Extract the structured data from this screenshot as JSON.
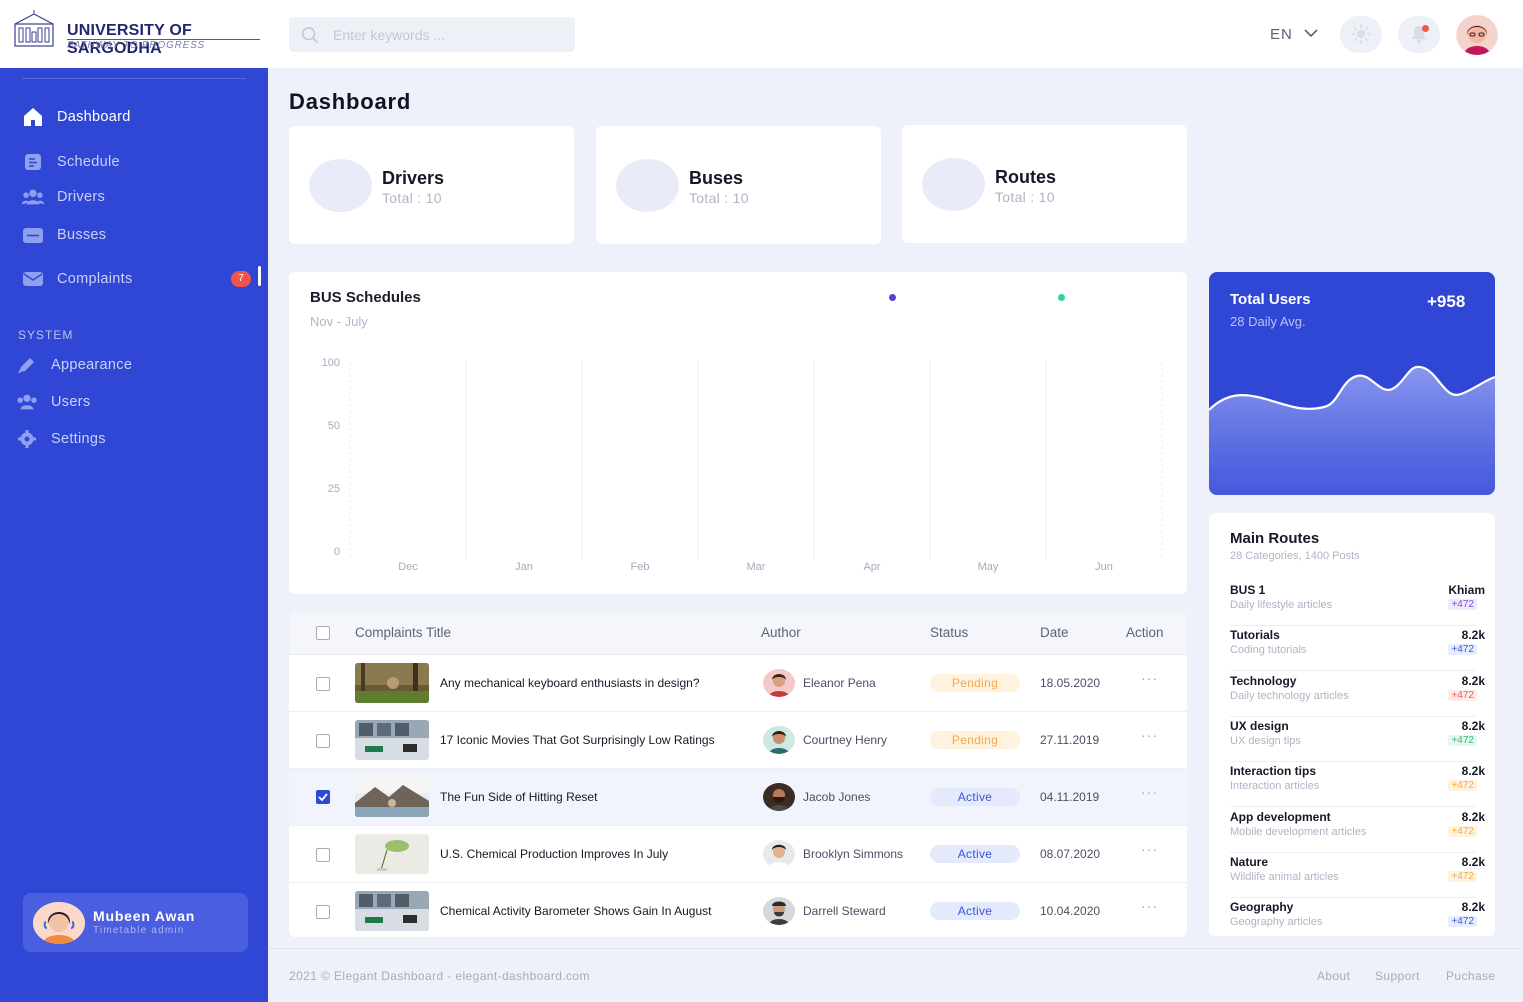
{
  "header": {
    "logo_title": "UNIVERSITY OF SARGODHA",
    "logo_subtitle": "PATHWAY TO PROGRESS",
    "search_placeholder": "Enter keywords ...",
    "language": "EN"
  },
  "sidebar": {
    "items": [
      {
        "label": "Dashboard",
        "icon": "home-icon"
      },
      {
        "label": "Schedule",
        "icon": "document-icon"
      },
      {
        "label": "Drivers",
        "icon": "users-icon"
      },
      {
        "label": "Busses",
        "icon": "folder-icon"
      },
      {
        "label": "Complaints",
        "icon": "mail-icon",
        "badge": "7"
      }
    ],
    "system_title": "SYSTEM",
    "system_items": [
      {
        "label": "Appearance",
        "icon": "pen-icon"
      },
      {
        "label": "Users",
        "icon": "users-icon"
      },
      {
        "label": "Settings",
        "icon": "gear-icon"
      }
    ],
    "user": {
      "name": "Mubeen Awan",
      "role": "Timetable admin"
    }
  },
  "main": {
    "title": "Dashboard",
    "stats": [
      {
        "title": "Drivers",
        "sub": "Total : 10"
      },
      {
        "title": "Buses",
        "sub": "Total : 10"
      },
      {
        "title": "Routes",
        "sub": "Total : 10"
      }
    ]
  },
  "chart_data": {
    "type": "bar",
    "title": "BUS Schedules",
    "subtitle": "Nov - July",
    "categories": [
      "Dec",
      "Jan",
      "Feb",
      "Mar",
      "Apr",
      "May",
      "Jun"
    ],
    "y_ticks": [
      "100",
      "50",
      "25",
      "0"
    ],
    "series": [
      {
        "color": "#5b3fd9",
        "values": [
          0,
          0,
          0,
          0,
          0,
          0,
          0
        ]
      },
      {
        "color": "#2fd39b",
        "values": [
          0,
          0,
          0,
          0,
          0,
          0,
          0
        ]
      }
    ]
  },
  "table": {
    "headers": {
      "title": "Complaints  Title",
      "author": "Author",
      "status": "Status",
      "date": "Date",
      "action": "Action"
    },
    "rows": [
      {
        "title": "Any mechanical keyboard enthusiasts in design?",
        "author": "Eleanor Pena",
        "status": "Pending",
        "date": "18.05.2020",
        "checked": false
      },
      {
        "title": "17 Iconic Movies That Got Surprisingly Low Ratings",
        "author": "Courtney Henry",
        "status": "Pending",
        "date": "27.11.2019",
        "checked": false
      },
      {
        "title": "The Fun Side of Hitting Reset",
        "author": "Jacob Jones",
        "status": "Active",
        "date": "04.11.2019",
        "checked": true
      },
      {
        "title": "U.S. Chemical Production Improves In July",
        "author": "Brooklyn Simmons",
        "status": "Active",
        "date": "08.07.2020",
        "checked": false
      },
      {
        "title": "Chemical Activity Barometer Shows Gain In August",
        "author": "Darrell Steward",
        "status": "Active",
        "date": "10.04.2020",
        "checked": false
      }
    ],
    "action_symbol": "···"
  },
  "users_card": {
    "title": "Total Users",
    "value": "+958",
    "sub": "28 Daily Avg."
  },
  "routes_card": {
    "title": "Main Routes",
    "sub": "28 Categories, 1400 Posts",
    "items": [
      {
        "name": "BUS 1",
        "desc": "Daily lifestyle articles",
        "value": "Khiam",
        "badge": "+472",
        "badge_color": "#7b4fe0",
        "badge_bg": "#efe9fd"
      },
      {
        "name": "Tutorials",
        "desc": "Coding tutorials",
        "value": "8.2k",
        "badge": "+472",
        "badge_color": "#3a56d8",
        "badge_bg": "#e8edfc"
      },
      {
        "name": "Technology",
        "desc": "Daily technology articles",
        "value": "8.2k",
        "badge": "+472",
        "badge_color": "#ef5a5a",
        "badge_bg": "#fdecec"
      },
      {
        "name": "UX design",
        "desc": "UX design tips",
        "value": "8.2k",
        "badge": "+472",
        "badge_color": "#2fbf7a",
        "badge_bg": "#e6f8ef"
      },
      {
        "name": "Interaction tips",
        "desc": "Interaction articles",
        "value": "8.2k",
        "badge": "+472",
        "badge_color": "#f5a84a",
        "badge_bg": "#fff3e0"
      },
      {
        "name": "App development",
        "desc": "Mobile development articles",
        "value": "8.2k",
        "badge": "+472",
        "badge_color": "#f5a84a",
        "badge_bg": "#fff3e0"
      },
      {
        "name": "Nature",
        "desc": "Wildlife animal articles",
        "value": "8.2k",
        "badge": "+472",
        "badge_color": "#f5a84a",
        "badge_bg": "#fff3e0"
      },
      {
        "name": "Geography",
        "desc": "Geography articles",
        "value": "8.2k",
        "badge": "+472",
        "badge_color": "#3a56d8",
        "badge_bg": "#e8edfc"
      }
    ]
  },
  "footer": {
    "copyright": "2021 © Elegant Dashboard - elegant-dashboard.com",
    "links": [
      "About",
      "Support",
      "Puchase"
    ]
  },
  "colors": {
    "sidebar": "#3047d6",
    "accent": "#2f49d1",
    "background": "#eef1f9"
  }
}
